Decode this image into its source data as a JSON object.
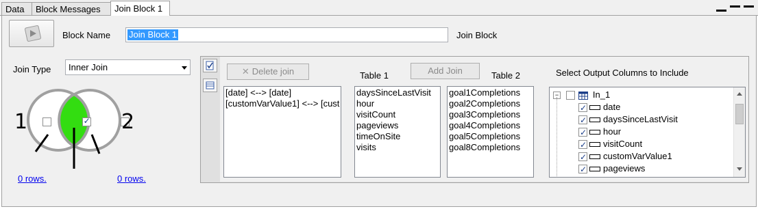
{
  "tabs": [
    {
      "label": "Data"
    },
    {
      "label": "Block Messages"
    },
    {
      "label": "Join Block 1"
    }
  ],
  "block": {
    "name_label": "Block Name",
    "name_value": "Join Block 1",
    "type_label": "Join Block"
  },
  "join": {
    "type_label": "Join Type",
    "type_value": "Inner Join",
    "venn_label_left": "1",
    "venn_label_right": "2",
    "rows_left": "0 rows.",
    "rows_right": "0 rows."
  },
  "toolbar": {
    "delete_join": "Delete join",
    "add_join": "Add Join"
  },
  "joins": [
    "[date] <--> [date]",
    "[customVarValue1] <--> [cust"
  ],
  "table1": {
    "header": "Table 1",
    "items": [
      "daysSinceLastVisit",
      "hour",
      "visitCount",
      "pageviews",
      "timeOnSite",
      "visits"
    ]
  },
  "table2": {
    "header": "Table 2",
    "items": [
      "goal1Completions",
      "goal2Completions",
      "goal3Completions",
      "goal4Completions",
      "goal5Completions",
      "goal8Completions"
    ]
  },
  "output": {
    "header": "Select Output Columns to Include",
    "root": "In_1",
    "columns": [
      "date",
      "daysSinceLastVisit",
      "hour",
      "visitCount",
      "customVarValue1",
      "pageviews"
    ]
  },
  "colors": {
    "venn_fill": "#33dd11",
    "selection": "#3399ff"
  }
}
